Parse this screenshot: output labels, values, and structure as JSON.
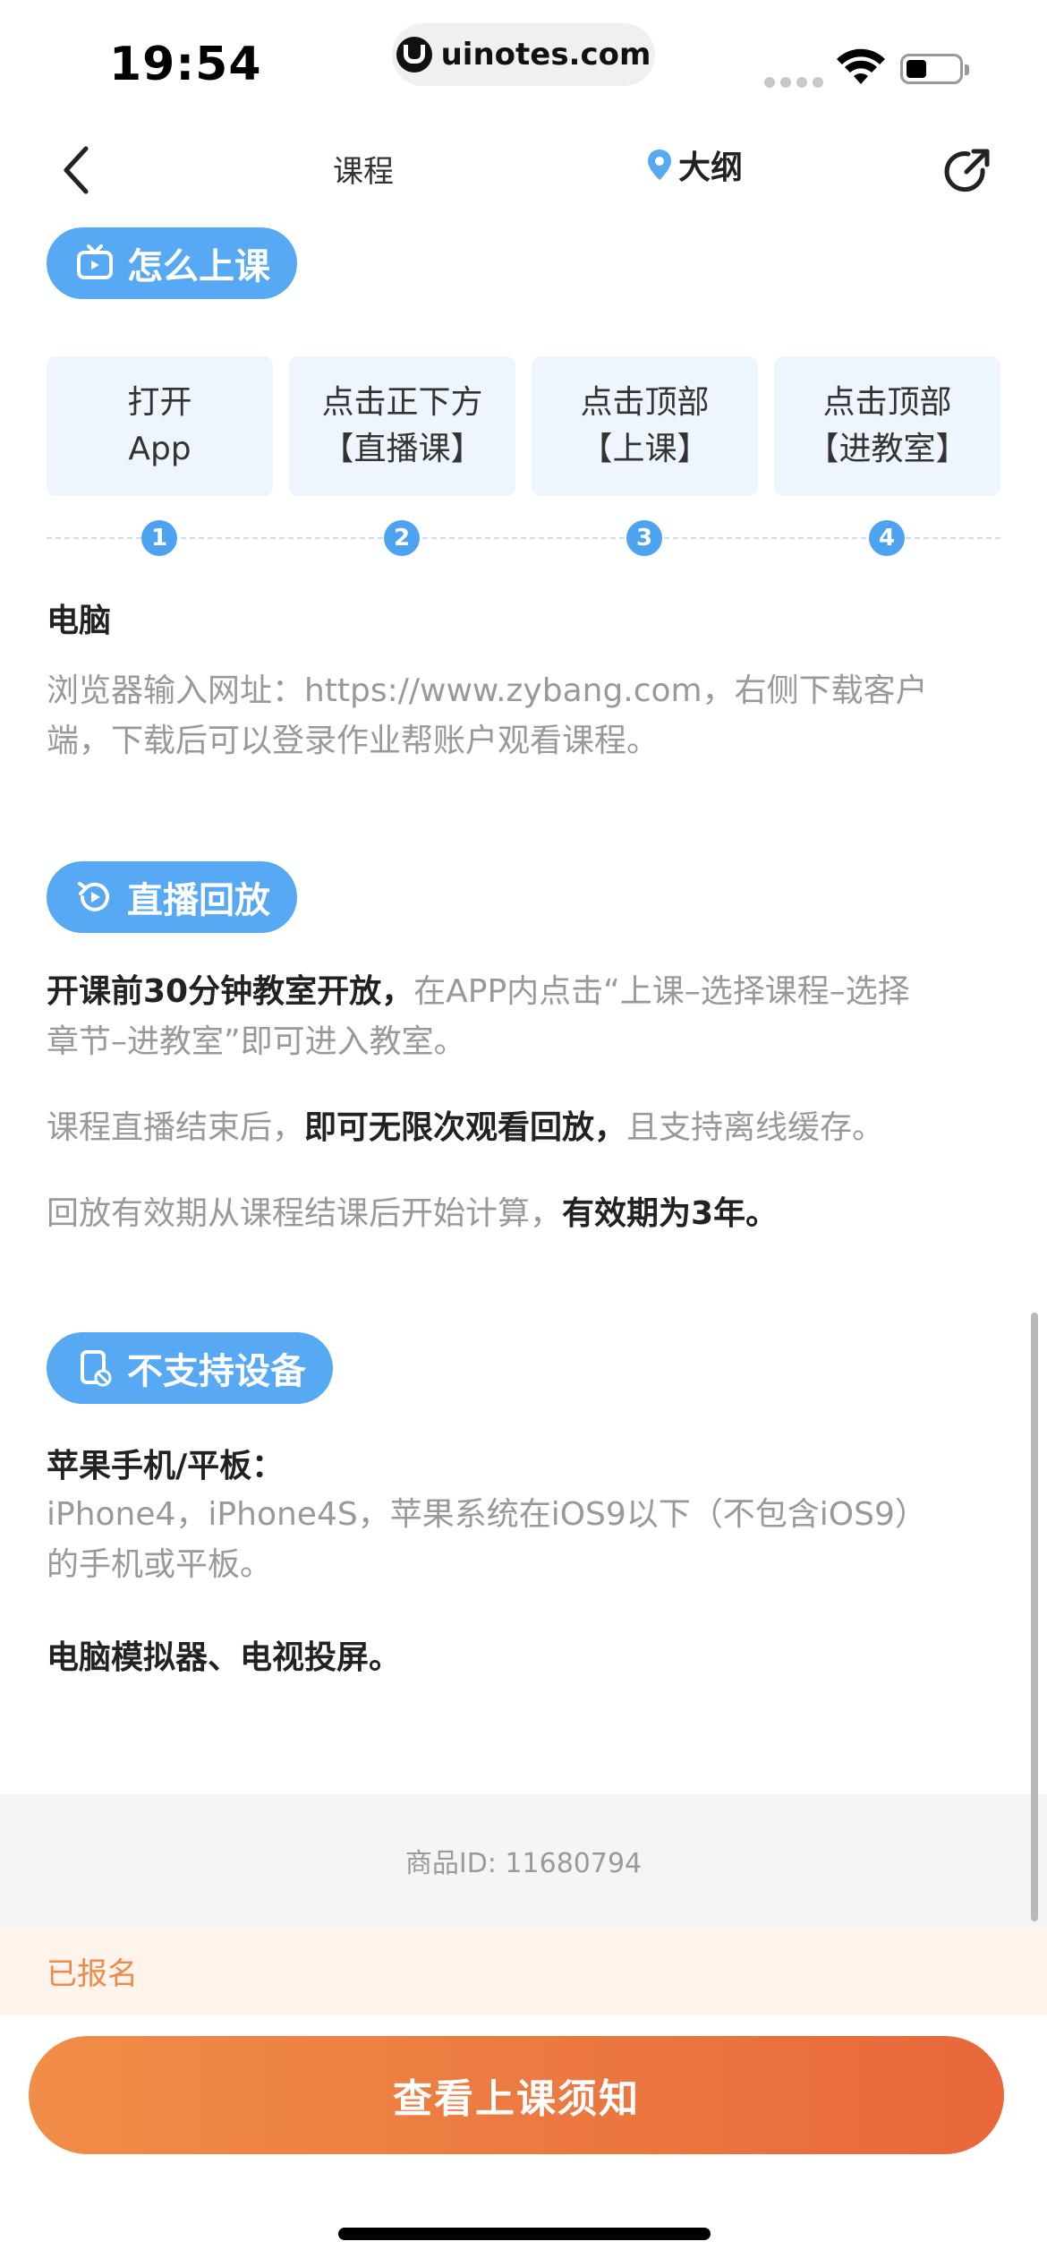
{
  "status_bar": {
    "time": "19:54",
    "url": "uinotes.com"
  },
  "nav": {
    "course": "课程",
    "outline": "大纲"
  },
  "how_to": {
    "tag": "怎么上课",
    "steps": [
      {
        "line1": "打开",
        "line2": "App"
      },
      {
        "line1": "点击正下方",
        "line2": "【直播课】"
      },
      {
        "line1": "点击顶部",
        "line2": "【上课】"
      },
      {
        "line1": "点击顶部",
        "line2": "【进教室】"
      }
    ],
    "step_numbers": [
      "1",
      "2",
      "3",
      "4"
    ],
    "pc_title": "电脑",
    "pc_text_line1": "浏览器输入网址：https://www.zybang.com，右侧下载客户",
    "pc_text_line2": "端，下载后可以登录作业帮账户观看课程。"
  },
  "replay": {
    "tag": "直播回放",
    "p1_bold": "开课前30分钟教室开放，",
    "p1_rest": "在APP内点击“上课–选择课程–选择",
    "p1_line2": "章节–进教室”即可进入教室。",
    "p2_pre": "课程直播结束后，",
    "p2_bold": "即可无限次观看回放，",
    "p2_post": "且支持离线缓存。",
    "p3_pre": "回放有效期从课程结课后开始计算，",
    "p3_bold": "有效期为3年。"
  },
  "unsupported": {
    "tag": "不支持设备",
    "apple_title": "苹果手机/平板：",
    "apple_line1": "iPhone4，iPhone4S，苹果系统在iOS9以下（不包含iOS9）",
    "apple_line2": "的手机或平板。",
    "other": "电脑模拟器、电视投屏。"
  },
  "footer": {
    "goods_id": "商品ID: 11680794",
    "enrolled": "已报名",
    "cta": "查看上课须知"
  },
  "colors": {
    "accent_blue": "#57a9f4",
    "cta_orange": "#e8683a",
    "enrolled_text": "#ef8a4c"
  }
}
